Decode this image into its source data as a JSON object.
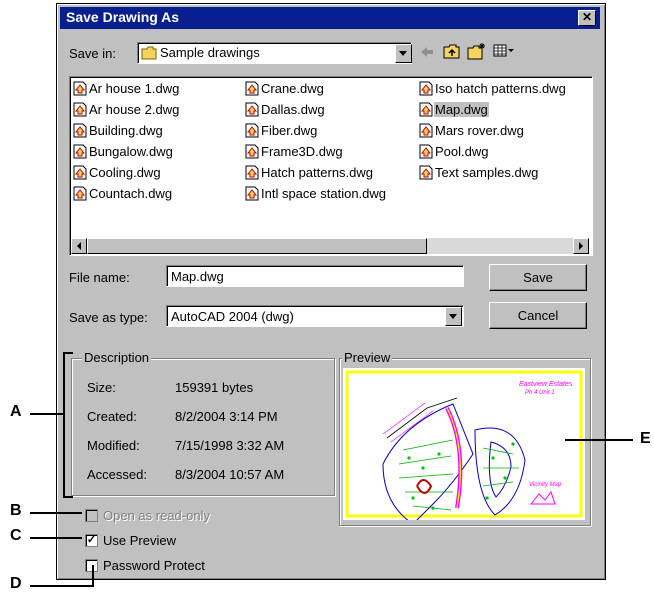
{
  "dialog": {
    "title": "Save Drawing As",
    "close_glyph": "✕"
  },
  "toolbar": {
    "save_in_label": "Save in:",
    "folder": "Sample drawings"
  },
  "files": [
    "Ar house 1.dwg",
    "Ar house 2.dwg",
    "Building.dwg",
    "Bungalow.dwg",
    "Cooling.dwg",
    "Countach.dwg",
    "Crane.dwg",
    "Dallas.dwg",
    "Fiber.dwg",
    "Frame3D.dwg",
    "Hatch patterns.dwg",
    "Intl space station.dwg",
    "Iso hatch patterns.dwg",
    "Map.dwg",
    "Mars rover.dwg",
    "Pool.dwg",
    "Text samples.dwg"
  ],
  "selected_file": "Map.dwg",
  "form": {
    "file_name_label": "File name:",
    "file_name_value": "Map.dwg",
    "type_label": "Save as type:",
    "type_value": "AutoCAD 2004 (dwg)",
    "save_button": "Save",
    "cancel_button": "Cancel"
  },
  "description": {
    "title": "Description",
    "rows": [
      {
        "label": "Size:",
        "value": "159391 bytes"
      },
      {
        "label": "Created:",
        "value": "8/2/2004 3:14 PM"
      },
      {
        "label": "Modified:",
        "value": "7/15/1998 3:32 AM"
      },
      {
        "label": "Accessed:",
        "value": "8/3/2004 10:57 AM"
      }
    ]
  },
  "preview": {
    "title": "Preview",
    "map_title_line1": "Eastview Estates",
    "map_title_line2": "Ph 4 Unit 1",
    "vicinity_label": "Vicinity Map"
  },
  "options": {
    "read_only": {
      "label": "Open as read-only",
      "checked": false,
      "disabled": true
    },
    "use_preview": {
      "label": "Use Preview",
      "checked": true
    },
    "password": {
      "label": "Password Protect",
      "checked": false
    }
  },
  "callouts": {
    "a": "A",
    "b": "B",
    "c": "C",
    "d": "D",
    "e": "E"
  },
  "colors": {
    "title_bar": "#0a1f8f",
    "dialog_bg": "#c0c0c0",
    "folder_yellow": "#f4d35e",
    "preview_border": "#ffff00",
    "map_magenta": "#ff00ff",
    "map_green": "#00c800",
    "map_blue": "#0000c0"
  },
  "icons": [
    "folder-icon",
    "up-folder-icon",
    "new-folder-icon",
    "view-menu-icon",
    "back-arrow-icon",
    "dwg-file-icon"
  ]
}
